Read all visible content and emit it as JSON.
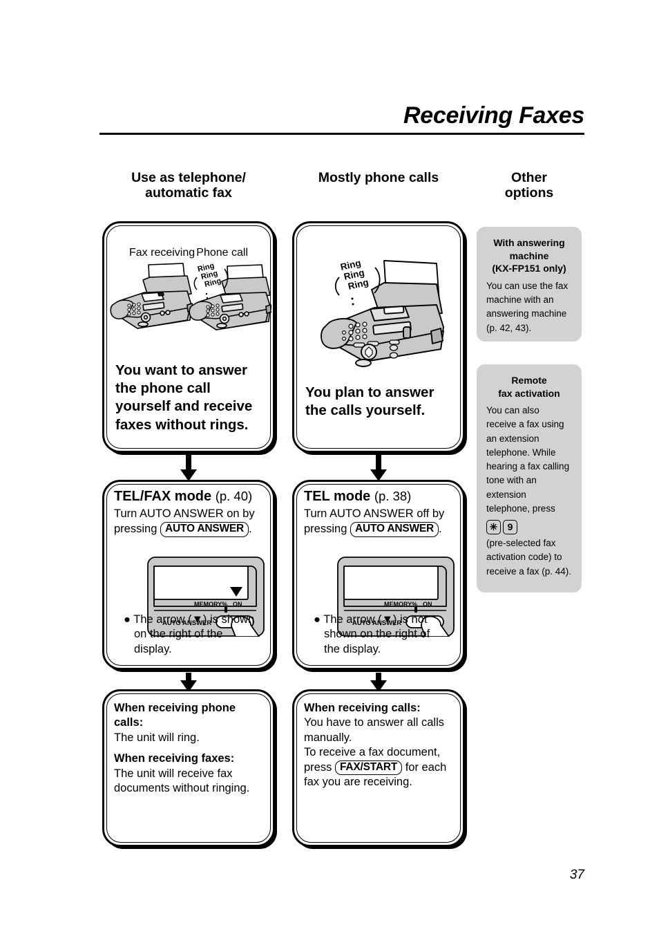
{
  "page": {
    "title": "Receiving Faxes",
    "number": "37"
  },
  "columns": {
    "col1_heading_line1": "Use as telephone/",
    "col1_heading_line2": "automatic fax",
    "col2_heading": "Mostly phone calls",
    "col3_heading_line1": "Other",
    "col3_heading_line2": "options"
  },
  "col1": {
    "top_box": {
      "caption_left": "Fax receiving",
      "caption_right": "Phone call",
      "ring_text": "Ring\nRing\nRing",
      "statement": "You want to answer the phone call yourself and receive faxes without rings."
    },
    "mode_box": {
      "mode_title": "TEL/FAX mode",
      "page_ref": "(p. 40)",
      "instruction_pre": "Turn AUTO ANSWER on by",
      "instruction_press": "pressing",
      "key_label": "AUTO ANSWER",
      "instruction_post": ".",
      "panel_memory_label": "MEMORY%",
      "panel_on_label": "ON",
      "panel_auto_answer_label": "AUTO ANSWER",
      "arrow_shown": true,
      "note": "The arrow (▼) is shown on the right of the display."
    },
    "result_box": {
      "head1": "When receiving phone calls:",
      "body1": "The unit will ring.",
      "head2": "When receiving faxes:",
      "body2": "The unit will receive fax documents without ringing."
    }
  },
  "col2": {
    "top_box": {
      "ring_text": "Ring\nRing\nRing",
      "statement": "You plan to answer the calls yourself."
    },
    "mode_box": {
      "mode_title": "TEL mode",
      "page_ref": "(p. 38)",
      "instruction_pre": "Turn AUTO ANSWER off by",
      "instruction_press": "pressing",
      "key_label": "AUTO ANSWER",
      "instruction_post": ".",
      "panel_memory_label": "MEMORY%",
      "panel_on_label": "ON",
      "panel_auto_answer_label": "AUTO ANSWER",
      "arrow_shown": false,
      "note": "The arrow (▼) is not shown on the right of the display."
    },
    "result_box": {
      "head1": "When receiving calls:",
      "body1": "You have to answer all calls manually.",
      "body2_pre": "To receive a fax document, press",
      "key_label": "FAX/START",
      "body2_post": "for each fax you are receiving."
    }
  },
  "col3": {
    "box1": {
      "title_line1": "With answering",
      "title_line2": "machine",
      "title_line3": "(KX-FP151 only)",
      "body": "You can use the fax machine with an answering machine (p. 42, 43)."
    },
    "box2": {
      "title_line1": "Remote",
      "title_line2": "fax activation",
      "body_pre": "You can also receive a fax using an extension telephone. While hearing a fax calling tone with an extension telephone, press",
      "key1": "✳",
      "key2": "9",
      "body_post": "(pre-selected fax activation code) to receive a fax (p. 44)."
    }
  },
  "colors": {
    "sidebar_bg": "#d2d2d2",
    "machine_body": "#c9c9c9",
    "ink": "#000000"
  }
}
